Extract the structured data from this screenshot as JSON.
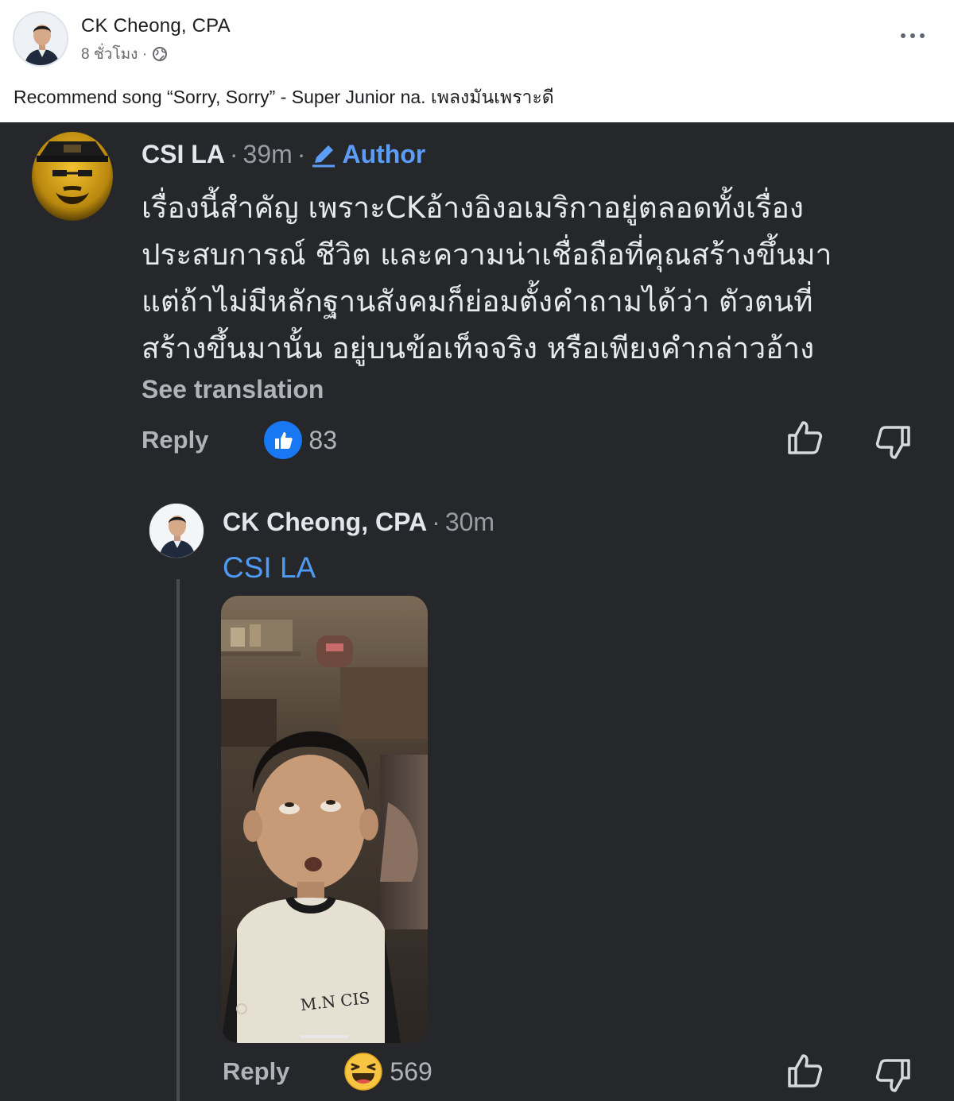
{
  "post": {
    "author": "CK Cheong, CPA",
    "time": "8 ชั่วโมง ·",
    "text": "Recommend song “Sorry, Sorry” - Super Junior na. เพลงมันเพราะดี",
    "more_icon": "more-horizontal-icon",
    "privacy_icon": "globe-icon"
  },
  "comment1": {
    "name": "CSI LA",
    "time": "39m",
    "separator": "·",
    "badge": "Author",
    "lines": [
      "เรื่องนี้สำคัญ เพราะCKอ้างอิงอเมริกาอยู่ตลอดทั้งเรื่อง",
      "ประสบการณ์ ชีวิต และความน่าเชื่อถือที่คุณสร้างขึ้นมา",
      "แต่ถ้าไม่มีหลักฐานสังคมก็ย่อมตั้งคำถามได้ว่า ตัวตนที่",
      "สร้างขึ้นมานั้น อยู่บนข้อเท็จจริง หรือเพียงคำกล่าวอ้าง"
    ],
    "see_translation": "See translation",
    "reply": "Reply",
    "reaction_count": "83",
    "reaction_icon": "like-icon"
  },
  "comment2": {
    "name": "CK Cheong, CPA",
    "time": "30m",
    "separator": "·",
    "mention": "CSI LA",
    "reply": "Reply",
    "reaction_count": "569",
    "reaction_icon": "haha-emoji-icon"
  },
  "colors": {
    "dark_bg": "#26272b",
    "accent_blue": "#5b9df7",
    "like_blue": "#1877f2"
  }
}
